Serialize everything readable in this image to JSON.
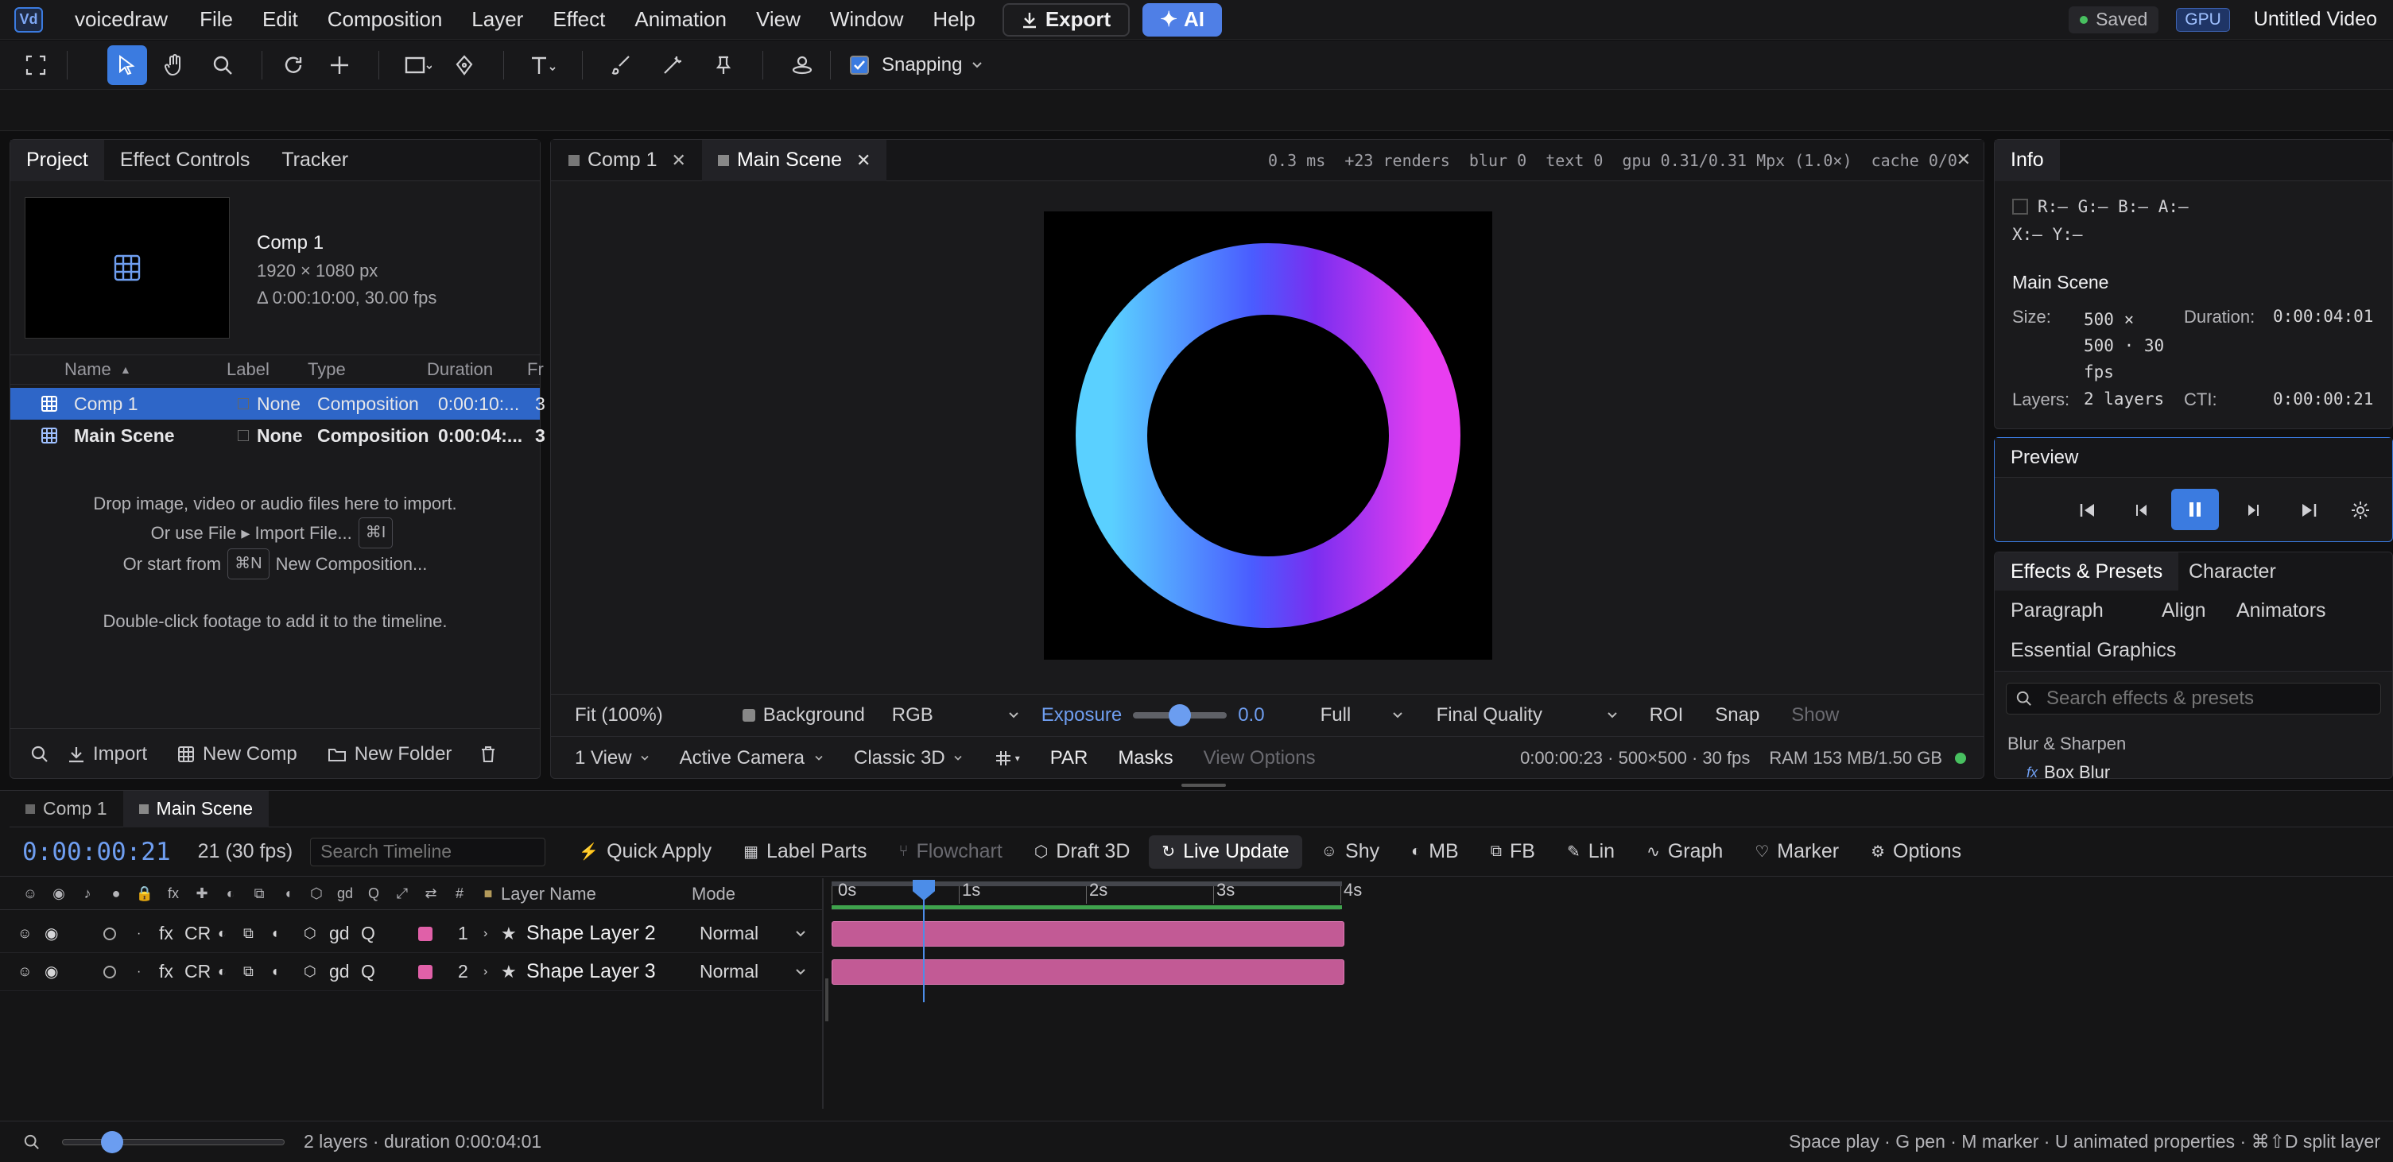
{
  "app": {
    "logo": "Vd",
    "name": "voicedraw",
    "menu": [
      "File",
      "Edit",
      "Composition",
      "Layer",
      "Effect",
      "Animation",
      "View",
      "Window",
      "Help"
    ],
    "export_label": "Export",
    "ai_label": "AI",
    "saved_label": "Saved",
    "gpu_label": "GPU",
    "doc_title": "Untitled Video"
  },
  "toolbar": {
    "snapping_label": "Snapping",
    "tools": [
      "expand-icon",
      "select-arrow-icon",
      "hand-icon",
      "zoom-icon",
      "rotate-icon",
      "anchor-icon",
      "rectangle-icon",
      "pen-icon",
      "text-icon",
      "brush-icon",
      "puppet-icon",
      "pin-icon",
      "camera-orbit-icon"
    ]
  },
  "project": {
    "tabs": [
      "Project",
      "Effect Controls",
      "Tracker"
    ],
    "preview": {
      "name": "Comp 1",
      "size": "1920 × 1080 px",
      "duration": "Δ 0:00:10:00, 30.00 fps"
    },
    "columns": [
      "Name",
      "Label",
      "Type",
      "Duration",
      "Fr"
    ],
    "rows": [
      {
        "name": "Comp 1",
        "label": "None",
        "type": "Composition",
        "duration": "0:00:10:...",
        "fr": "3"
      },
      {
        "name": "Main Scene",
        "label": "None",
        "type": "Composition",
        "duration": "0:00:04:...",
        "fr": "3"
      }
    ],
    "hint1": "Drop image, video or audio files here to import.",
    "hint2a": "Or use File ▸ Import File...",
    "hint2k": "⌘I",
    "hint3a": "Or start from",
    "hint3k": "⌘N",
    "hint3b": "New Composition...",
    "hint4": "Double-click footage to add it to the timeline.",
    "footer": [
      "Import",
      "New Comp",
      "New Folder"
    ]
  },
  "viewer": {
    "tabs": [
      "Comp 1",
      "Main Scene"
    ],
    "stats": "0.3 ms  +23 renders  blur 0  text 0  gpu 0.31/0.31 Mpx (1.0×)  cache 0/0",
    "fit": "Fit (100%)",
    "background": "Background",
    "channel": "RGB",
    "exposure_label": "Exposure",
    "exposure_value": "0.0",
    "resolution": "Full",
    "quality": "Final Quality",
    "roi": "ROI",
    "snap": "Snap",
    "show": "Show",
    "views": "1 View",
    "camera": "Active Camera",
    "renderer": "Classic 3D",
    "par": "PAR",
    "masks": "Masks",
    "view_options": "View Options",
    "status": "0:00:00:23 · 500×500 · 30 fps",
    "ram": "RAM 153 MB/1.50 GB",
    "ring_colors": [
      "#5ad0ff",
      "#4a5cff",
      "#7a2ef0",
      "#e83ef0"
    ]
  },
  "info": {
    "title": "Info",
    "rgba": "R:– G:– B:– A:–",
    "xy": "X:– Y:–",
    "scene": "Main Scene",
    "size_label": "Size:",
    "size_value": [
      "500 ×",
      "500 · 30",
      "fps"
    ],
    "duration_label": "Duration:",
    "duration_value": "0:00:04:01",
    "layers_label": "Layers:",
    "layers_value": "2 layers",
    "cti_label": "CTI:",
    "cti_value": "0:00:00:21"
  },
  "preview": {
    "title": "Preview"
  },
  "effects": {
    "tabs": [
      "Effects & Presets",
      "Character",
      "Paragraph",
      "Align",
      "Animators",
      "Essential Graphics"
    ],
    "search_placeholder": "Search effects & presets",
    "category": "Blur & Sharpen",
    "item": "Box Blur"
  },
  "timeline": {
    "tabs": [
      "Comp 1",
      "Main Scene"
    ],
    "timecode": "0:00:00:21",
    "frame": "21 (30 fps)",
    "search_placeholder": "Search Timeline",
    "buttons": [
      "Quick Apply",
      "Label Parts",
      "Flowchart",
      "Draft 3D",
      "Live Update",
      "Shy",
      "MB",
      "FB",
      "Lin",
      "Graph",
      "Marker",
      "Options"
    ],
    "col_layer_name": "Layer Name",
    "col_mode": "Mode",
    "ruler": [
      "0s",
      "1s",
      "2s",
      "3s",
      "4s"
    ],
    "layers": [
      {
        "num": "1",
        "name": "Shape Layer 2",
        "mode": "Normal",
        "color": "#e060a8"
      },
      {
        "num": "2",
        "name": "Shape Layer 3",
        "mode": "Normal",
        "color": "#e060a8"
      }
    ],
    "switch_glyphs": [
      "fx",
      "CR",
      "gd",
      "Q"
    ],
    "header_glyphs": [
      "fx",
      "gd",
      "Q",
      "#"
    ],
    "duration_sec": 4.03,
    "current_sec": 0.7
  },
  "statusbar": {
    "summary": "2 layers · duration 0:00:04:01",
    "shortcuts": "Space play · G pen · M marker · U animated properties · ⌘⇧D split layer"
  }
}
